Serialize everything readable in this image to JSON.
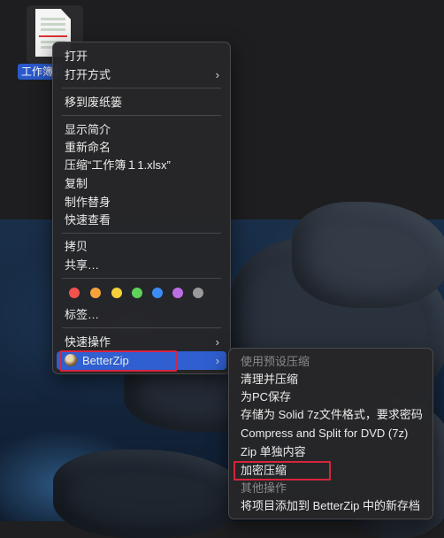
{
  "desktop": {
    "file_label": "工作簿1"
  },
  "context_menu": {
    "items": [
      {
        "label": "打开"
      },
      {
        "label": "打开方式",
        "submenu": true
      },
      {
        "label": "移到废纸篓"
      },
      {
        "label": "显示简介"
      },
      {
        "label": "重新命名"
      },
      {
        "label": "压缩“工作簿１1.xlsx”"
      },
      {
        "label": "复制"
      },
      {
        "label": "制作替身"
      },
      {
        "label": "快速查看"
      },
      {
        "label": "拷贝"
      },
      {
        "label": "共享…"
      },
      {
        "label": "标签…"
      },
      {
        "label": "快速操作",
        "submenu": true
      },
      {
        "label": "BetterZip",
        "submenu": true,
        "selected": true
      }
    ],
    "tag_colors": [
      "#f0524c",
      "#f5a33a",
      "#f6d03b",
      "#5fd25a",
      "#3b8df5",
      "#bd6ee3",
      "#9a9a9c"
    ],
    "chevron": "›"
  },
  "sub_menu": {
    "header_presets": "使用预设压缩",
    "items": [
      {
        "label": "清理并压缩"
      },
      {
        "label": "为PC保存"
      },
      {
        "label": "存储为 Solid 7z文件格式，要求密码"
      },
      {
        "label": "Compress and Split for DVD (7z)"
      },
      {
        "label": "Zip 单独内容"
      },
      {
        "label": "加密压缩"
      }
    ],
    "header_other": "其他操作",
    "other_items": [
      {
        "label": "将项目添加到 BetterZip 中的新存档"
      }
    ]
  },
  "highlight_color": "#d6253d"
}
